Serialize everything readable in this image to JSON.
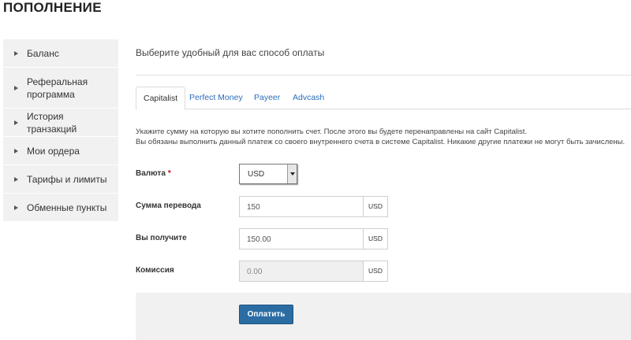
{
  "page": {
    "title": "ПОПОЛНЕНИЕ"
  },
  "sidebar": {
    "items": [
      {
        "label": "Баланс"
      },
      {
        "label": "Реферальная программа"
      },
      {
        "label": "История транзакций"
      },
      {
        "label": "Мои ордера"
      },
      {
        "label": "Тарифы и лимиты"
      },
      {
        "label": "Обменные пункты"
      }
    ]
  },
  "main": {
    "subtitle": "Выберите удобный для вас способ оплаты",
    "tabs": [
      {
        "label": "Capitalist",
        "active": true
      },
      {
        "label": "Perfect Money",
        "active": false
      },
      {
        "label": "Payeer",
        "active": false
      },
      {
        "label": "Advcash",
        "active": false
      }
    ],
    "info_line1": "Укажите сумму на которую вы хотите пополнить счет. После этого вы будете перенаправлены на сайт Capitalist.",
    "info_line2": "Вы обязаны выполнить данный платеж со своего внутреннего счета в системе Capitalist. Никакие другие платежи не могут быть зачислены.",
    "form": {
      "currency_label": "Валюта",
      "currency_required": "*",
      "currency_value": "USD",
      "amount_label": "Сумма перевода",
      "amount_value": "150",
      "amount_unit": "USD",
      "receive_label": "Вы получите",
      "receive_value": "150.00",
      "receive_unit": "USD",
      "fee_label": "Комиссия",
      "fee_value": "0.00",
      "fee_unit": "USD"
    },
    "pay_button": "Оплатить"
  },
  "colors": {
    "link": "#2a6ebb",
    "primary_button": "#2b6ca3",
    "required": "#d0021b",
    "sidebar_bg": "#f1f1f1"
  }
}
